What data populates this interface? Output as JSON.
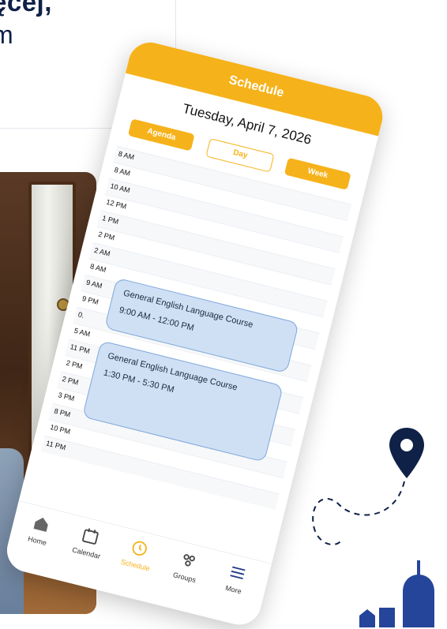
{
  "headline": {
    "line1": "ęcej,",
    "line2": "m"
  },
  "app": {
    "header_title": "Schedule",
    "date_title": "Tuesday, April 7, 2026",
    "views": [
      "Agenda",
      "Day",
      "Week"
    ],
    "time_labels": [
      "8 AM",
      "8 AM",
      "10 AM",
      "12 PM",
      "1 PM",
      "2 PM",
      "2 AM",
      "8 AM",
      "9 AM",
      "9 PM",
      "0.",
      "5 AM",
      "11 PM",
      "2 PM",
      "2 PM",
      "3 PM",
      "8 PM",
      "10 PM",
      "11 PM"
    ],
    "events": [
      {
        "title": "General English Language Course",
        "time": "9:00 AM - 12:00 PM"
      },
      {
        "title": "General English Language Course",
        "time": "1:30 PM - 5:30 PM"
      }
    ],
    "bottom_nav": [
      {
        "label": "Home",
        "icon": "home-icon"
      },
      {
        "label": "Calendar",
        "icon": "calendar-icon"
      },
      {
        "label": "Schedule",
        "icon": "clock-icon",
        "active": true
      },
      {
        "label": "Groups",
        "icon": "groups-icon"
      },
      {
        "label": "More",
        "icon": "menu-icon"
      }
    ]
  },
  "colors": {
    "accent": "#f6b21a",
    "event_bg": "#cfe0f5",
    "navy": "#0f2147"
  }
}
